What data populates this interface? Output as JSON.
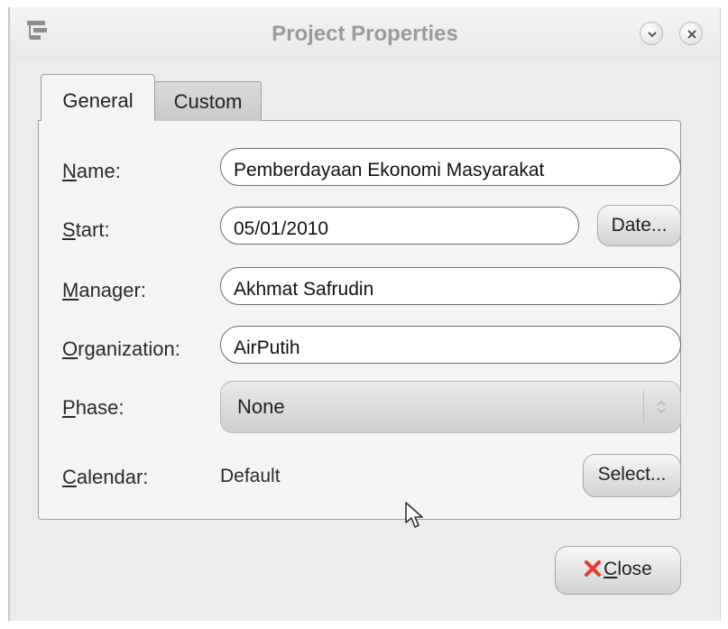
{
  "window": {
    "title": "Project Properties",
    "icons": [
      "app-icon",
      "minimize-icon",
      "close-icon"
    ]
  },
  "tabs": [
    {
      "label": "General",
      "active": true
    },
    {
      "label": "Custom",
      "active": false
    }
  ],
  "form": {
    "name_label_mnemonic": "N",
    "name_label_rest": "ame:",
    "name_value": "Pemberdayaan Ekonomi Masyarakat",
    "start_label_mnemonic": "S",
    "start_label_rest": "tart:",
    "start_value": "05/01/2010",
    "date_button": "Date...",
    "manager_label_mnemonic": "M",
    "manager_label_rest": "anager:",
    "manager_value": "Akhmat Safrudin",
    "organization_label_mnemonic": "O",
    "organization_label_rest": "rganization:",
    "organization_value": "AirPutih",
    "phase_label_mnemonic": "P",
    "phase_label_rest": "hase:",
    "phase_value": "None",
    "calendar_label_mnemonic": "C",
    "calendar_label_rest": "alendar:",
    "calendar_value": "Default",
    "select_button": "Select..."
  },
  "footer": {
    "close_mnemonic": "C",
    "close_rest": "lose"
  },
  "colors": {
    "close_x": "#e83a2a",
    "window_bg": "#ececec",
    "panel_bg": "#f4f4f4"
  }
}
